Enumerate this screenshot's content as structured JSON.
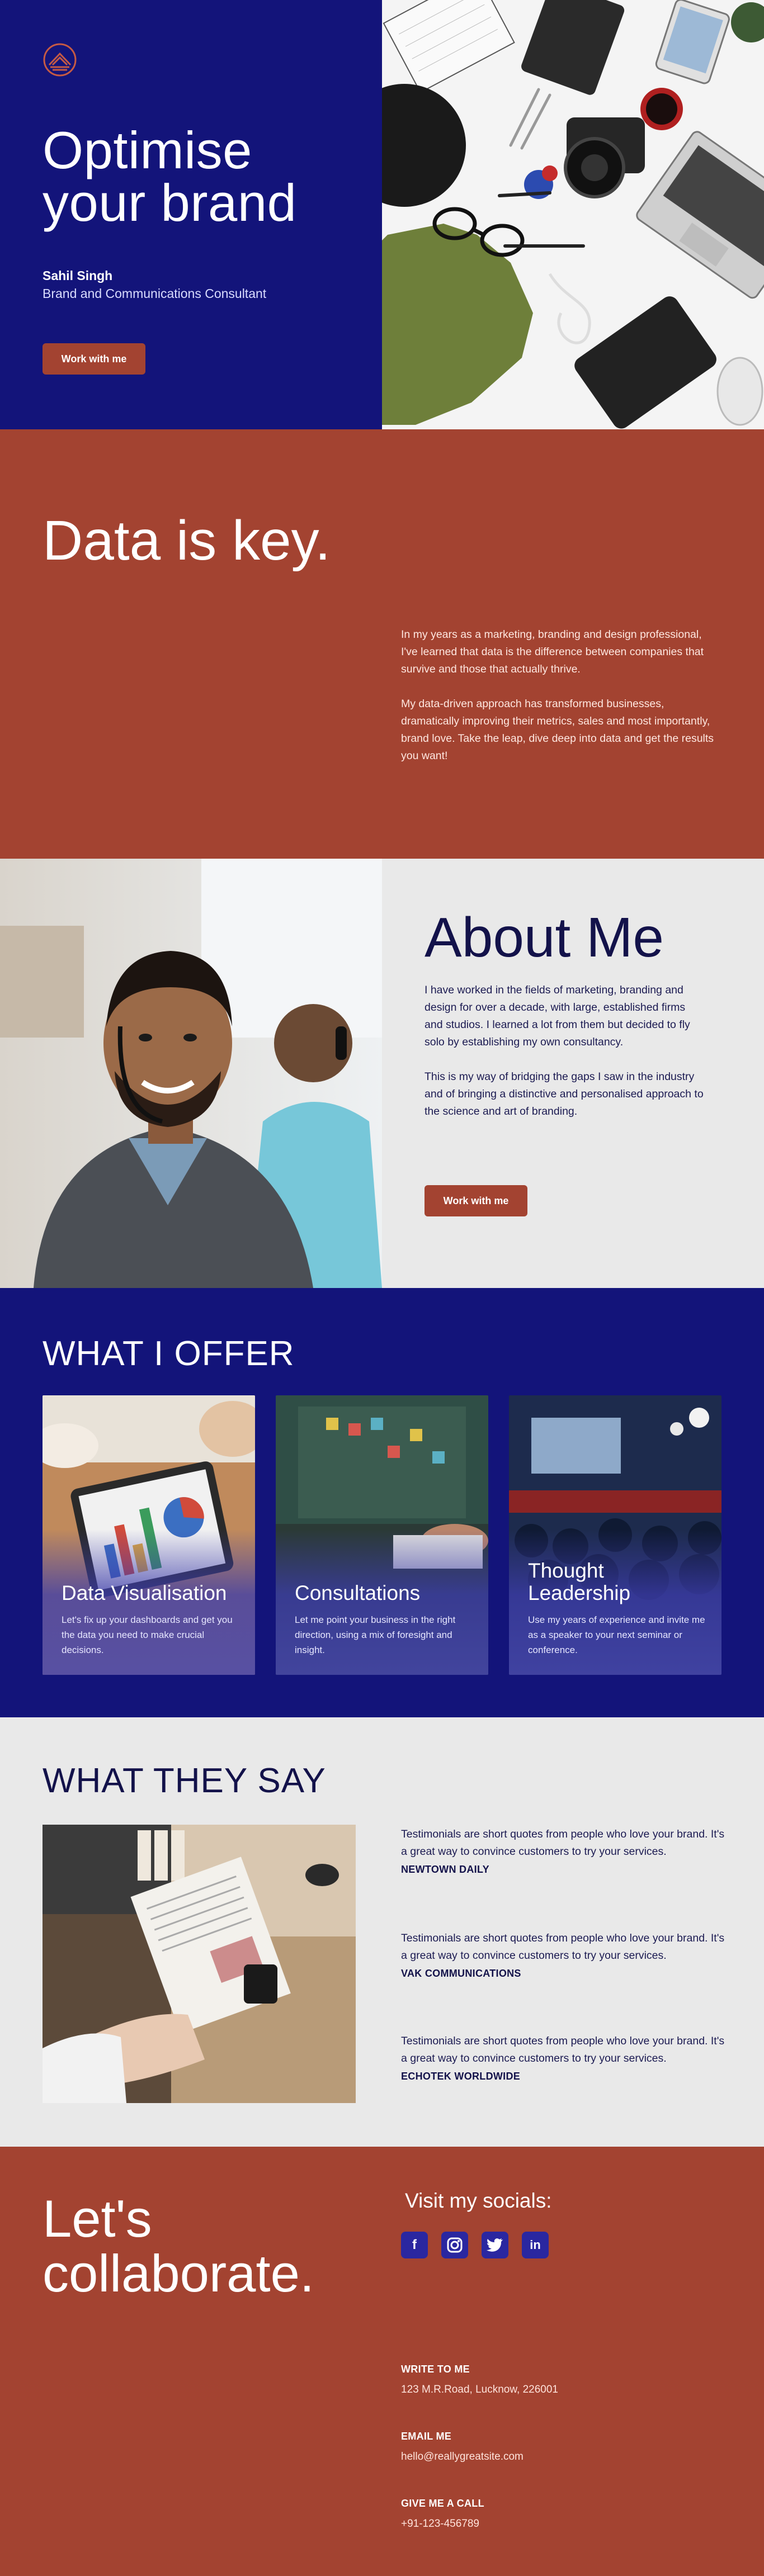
{
  "hero": {
    "title_line1": "Optimise",
    "title_line2": "your brand",
    "name": "Sahil Singh",
    "role": "Brand and Communications Consultant",
    "cta": "Work with me"
  },
  "data_section": {
    "title": "Data is key.",
    "paragraph1": "In my years as a marketing, branding and design professional, I've learned that data is the difference between companies that survive and those that actually thrive.",
    "paragraph2": "My data-driven approach has transformed businesses, dramatically improving their metrics, sales and most importantly, brand love. Take the leap, dive deep into data and get the results you want!"
  },
  "about": {
    "title": "About Me",
    "paragraph1": "I have worked in the fields of marketing, branding and design for over a decade, with large, established firms and studios. I learned a lot from them but decided to fly solo by establishing my own consultancy.",
    "paragraph2": "This is my way of bridging the gaps I saw in the industry and of bringing a distinctive and personalised approach to the science and art of branding.",
    "cta": "Work with me"
  },
  "offer": {
    "title": "WHAT I OFFER",
    "cards": [
      {
        "title": "Data Visualisation",
        "desc": "Let's fix up your dashboards and get you the data you need to make crucial decisions."
      },
      {
        "title": "Consultations",
        "desc": "Let me point your business in the right direction, using a mix of foresight and insight."
      },
      {
        "title": "Thought Leadership",
        "desc": "Use my years of experience and invite me as a speaker to your next seminar or conference."
      }
    ]
  },
  "testimonials": {
    "title": "WHAT THEY SAY",
    "items": [
      {
        "quote": "Testimonials are short quotes from people who love your brand. It's a great way to convince customers to try your services.",
        "company": "NEWTOWN DAILY"
      },
      {
        "quote": "Testimonials are short quotes from people who love your brand. It's a great way to convince customers to try your services.",
        "company": "VAK COMMUNICATIONS"
      },
      {
        "quote": "Testimonials are short quotes from people who love your brand. It's a great way to convince customers to try your services.",
        "company": "ECHOTEK WORLDWIDE"
      }
    ]
  },
  "contact": {
    "title_line1": "Let's",
    "title_line2": "collaborate.",
    "socials_label": "Visit my socials:",
    "socials": [
      {
        "icon": "facebook-icon",
        "glyph": "f"
      },
      {
        "icon": "instagram-icon",
        "glyph": "◎"
      },
      {
        "icon": "twitter-icon",
        "glyph": "🐦"
      },
      {
        "icon": "linkedin-icon",
        "glyph": "in"
      }
    ],
    "write_label": "WRITE TO ME",
    "address": "123 M.R.Road, Lucknow,  226001",
    "email_label": "EMAIL ME",
    "email": "hello@reallygreatsite.com",
    "call_label": "GIVE ME A CALL",
    "phone": "+91-123-456789"
  },
  "colors": {
    "navy": "#13147a",
    "rust": "#a34331",
    "light_gray": "#ebebeb"
  }
}
